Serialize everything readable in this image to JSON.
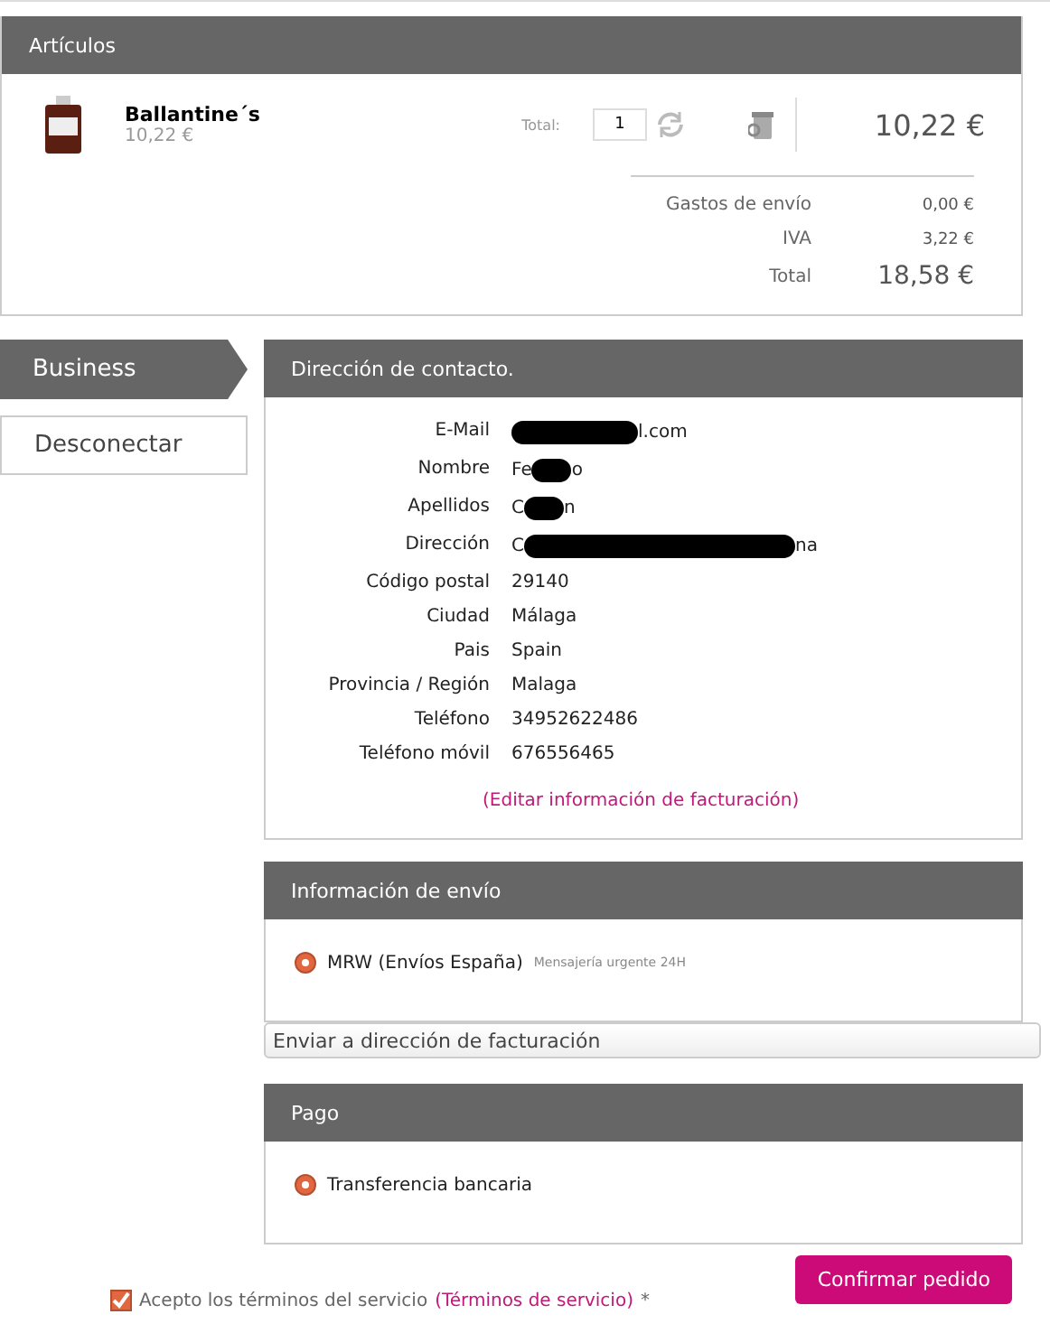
{
  "articles": {
    "title": "Artículos",
    "items": [
      {
        "name": "Ballantine´s",
        "unit_price": "10,22 €",
        "total_label": "Total:",
        "quantity": "1",
        "line_total": "10,22 €"
      }
    ],
    "summary": [
      {
        "label": "Gastos de envío",
        "value": "0,00 €",
        "kind": "small"
      },
      {
        "label": "IVA",
        "value": "3,22 €",
        "kind": "small"
      },
      {
        "label": "Total",
        "value": "18,58 €",
        "kind": "large"
      }
    ]
  },
  "sidebar": {
    "items": [
      {
        "label": "Business",
        "selected": true
      },
      {
        "label": "Desconectar",
        "selected": false
      }
    ]
  },
  "contact": {
    "title": "Dirección de contacto.",
    "rows": [
      {
        "label": "E-Mail",
        "before": "",
        "after": "l.com",
        "redacted": true
      },
      {
        "label": "Nombre",
        "before": "Fe",
        "after": "o",
        "redacted": true
      },
      {
        "label": "Apellidos",
        "before": "C",
        "after": "n",
        "redacted": true
      },
      {
        "label": "Dirección",
        "before": "C",
        "after": "na",
        "redacted": true
      },
      {
        "label": "Código postal",
        "before": "29140",
        "after": "",
        "redacted": false
      },
      {
        "label": "Ciudad",
        "before": "Málaga",
        "after": "",
        "redacted": false
      },
      {
        "label": "Pais",
        "before": "Spain",
        "after": "",
        "redacted": false
      },
      {
        "label": "Provincia / Región",
        "before": "Malaga",
        "after": "",
        "redacted": false
      },
      {
        "label": "Teléfono",
        "before": "34952622486",
        "after": "",
        "redacted": false
      },
      {
        "label": "Teléfono móvil",
        "before": "676556465",
        "after": "",
        "redacted": false
      }
    ],
    "edit_link": "(Editar información de facturación)"
  },
  "shipping": {
    "title": "Información de envío",
    "options": [
      {
        "label": "MRW (Envíos España)",
        "note": "Mensajería urgente 24H",
        "selected": true
      }
    ],
    "address_select": "Enviar a dirección de facturación"
  },
  "payment": {
    "title": "Pago",
    "options": [
      {
        "label": "Transferencia bancaria",
        "selected": true
      }
    ]
  },
  "terms": {
    "checked": true,
    "text": "Acepto los términos del servicio",
    "link": "(Términos de servicio)",
    "required_mark": "*"
  },
  "confirm_button": "Confirmar pedido"
}
